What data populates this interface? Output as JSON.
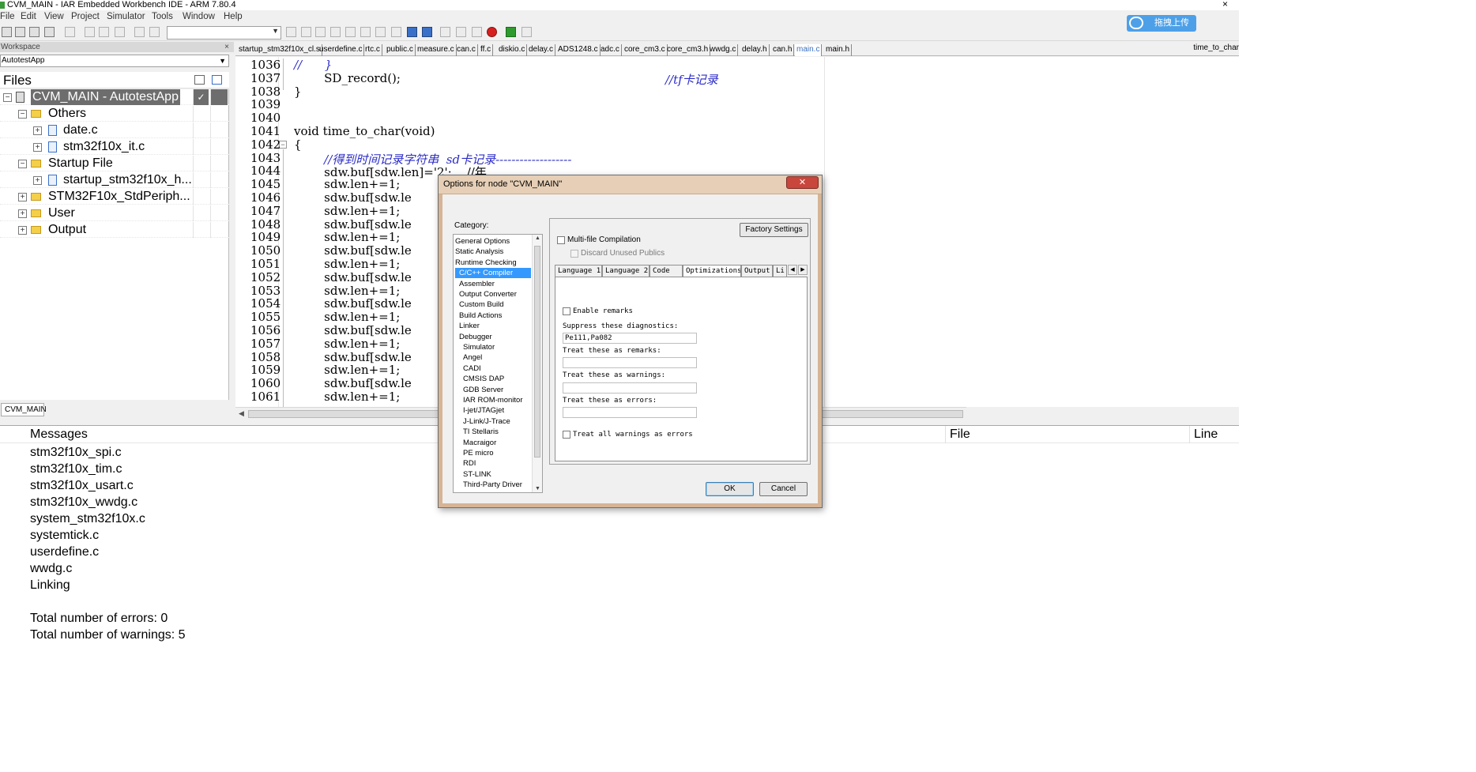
{
  "window": {
    "title": "CVM_MAIN - IAR Embedded Workbench IDE - ARM 7.80.4",
    "close_glyph": "×"
  },
  "menu": [
    "File",
    "Edit",
    "View",
    "Project",
    "Simulator",
    "Tools",
    "Window",
    "Help"
  ],
  "upload_button": "拖拽上传",
  "workspace": {
    "header": "Workspace",
    "close_glyph": "×",
    "config": "AutotestApp",
    "files_label": "Files",
    "tree": [
      {
        "label": "CVM_MAIN - AutotestApp",
        "type": "project",
        "selected": true,
        "check": "✓"
      },
      {
        "label": "Others",
        "type": "folder"
      },
      {
        "label": "date.c",
        "type": "file"
      },
      {
        "label": "stm32f10x_it.c",
        "type": "file"
      },
      {
        "label": "Startup File",
        "type": "folder"
      },
      {
        "label": "startup_stm32f10x_h...",
        "type": "file"
      },
      {
        "label": "STM32F10x_StdPeriph...",
        "type": "folder"
      },
      {
        "label": "User",
        "type": "folder"
      },
      {
        "label": "Output",
        "type": "folder"
      }
    ],
    "bottom_tab": "CVM_MAIN"
  },
  "editor": {
    "tabs": [
      "startup_stm32f10x_cl.s",
      "userdefine.c",
      "rtc.c",
      "public.c",
      "measure.c",
      "can.c",
      "ff.c",
      "diskio.c",
      "delay.c",
      "ADS1248.c",
      "adc.c",
      "core_cm3.c",
      "core_cm3.h",
      "wwdg.c",
      "delay.h",
      "can.h",
      "main.c",
      "main.h"
    ],
    "active_tab": "main.c",
    "function_combo": "time_to_char",
    "lines": [
      {
        "n": "1036",
        "code": "//      }"
      },
      {
        "n": "1037",
        "code": "        SD_record();",
        "comment": "//tf卡记录"
      },
      {
        "n": "1038",
        "code": "}"
      },
      {
        "n": "1039",
        "code": ""
      },
      {
        "n": "1040",
        "code": ""
      },
      {
        "n": "1041",
        "code": "void time_to_char(void)"
      },
      {
        "n": "1042",
        "code": "{"
      },
      {
        "n": "1043",
        "code": "        //得到时间记录字符串  sd卡记录-------------------"
      },
      {
        "n": "1044",
        "code": "        sdw.buf[sdw.len]='2';    //年"
      },
      {
        "n": "1045",
        "code": "        sdw.len+=1;"
      },
      {
        "n": "1046",
        "code": "        sdw.buf[sdw.le"
      },
      {
        "n": "1047",
        "code": "        sdw.len+=1;"
      },
      {
        "n": "1048",
        "code": "        sdw.buf[sdw.le"
      },
      {
        "n": "1049",
        "code": "        sdw.len+=1;"
      },
      {
        "n": "1050",
        "code": "        sdw.buf[sdw.le"
      },
      {
        "n": "1051",
        "code": "        sdw.len+=1;"
      },
      {
        "n": "1052",
        "code": "        sdw.buf[sdw.le"
      },
      {
        "n": "1053",
        "code": "        sdw.len+=1;"
      },
      {
        "n": "1054",
        "code": "        sdw.buf[sdw.le"
      },
      {
        "n": "1055",
        "code": "        sdw.len+=1;"
      },
      {
        "n": "1056",
        "code": "        sdw.buf[sdw.le"
      },
      {
        "n": "1057",
        "code": "        sdw.len+=1;"
      },
      {
        "n": "1058",
        "code": "        sdw.buf[sdw.le"
      },
      {
        "n": "1059",
        "code": "        sdw.len+=1;"
      },
      {
        "n": "1060",
        "code": "        sdw.buf[sdw.le"
      },
      {
        "n": "1061",
        "code": "        sdw.len+=1;"
      }
    ]
  },
  "messages": {
    "headers": {
      "messages": "Messages",
      "file": "File",
      "line": "Line"
    },
    "lines": [
      "stm32f10x_spi.c",
      "stm32f10x_tim.c",
      "stm32f10x_usart.c",
      "stm32f10x_wwdg.c",
      "system_stm32f10x.c",
      "systemtick.c",
      "userdefine.c",
      "wwdg.c",
      "Linking",
      "",
      "Total number of errors: 0",
      "Total number of warnings: 5"
    ]
  },
  "dialog": {
    "title": "Options for node \"CVM_MAIN\"",
    "close_glyph": "✕",
    "category_label": "Category:",
    "categories": [
      {
        "label": "General Options",
        "indent": 0
      },
      {
        "label": "Static Analysis",
        "indent": 0
      },
      {
        "label": "Runtime Checking",
        "indent": 0
      },
      {
        "label": "C/C++ Compiler",
        "indent": 1,
        "selected": true
      },
      {
        "label": "Assembler",
        "indent": 1
      },
      {
        "label": "Output Converter",
        "indent": 1
      },
      {
        "label": "Custom Build",
        "indent": 1
      },
      {
        "label": "Build Actions",
        "indent": 1
      },
      {
        "label": "Linker",
        "indent": 1
      },
      {
        "label": "Debugger",
        "indent": 1
      },
      {
        "label": "Simulator",
        "indent": 2
      },
      {
        "label": "Angel",
        "indent": 2
      },
      {
        "label": "CADI",
        "indent": 2
      },
      {
        "label": "CMSIS DAP",
        "indent": 2
      },
      {
        "label": "GDB Server",
        "indent": 2
      },
      {
        "label": "IAR ROM-monitor",
        "indent": 2
      },
      {
        "label": "I-jet/JTAGjet",
        "indent": 2
      },
      {
        "label": "J-Link/J-Trace",
        "indent": 2
      },
      {
        "label": "TI Stellaris",
        "indent": 2
      },
      {
        "label": "Macraigor",
        "indent": 2
      },
      {
        "label": "PE micro",
        "indent": 2
      },
      {
        "label": "RDI",
        "indent": 2
      },
      {
        "label": "ST-LINK",
        "indent": 2
      },
      {
        "label": "Third-Party Driver",
        "indent": 2
      }
    ],
    "factory_settings": "Factory Settings",
    "multi_file": "Multi-file Compilation",
    "discard_unused": "Discard Unused Publics",
    "subtabs": [
      "Language 1",
      "Language 2",
      "Code",
      "Optimizations",
      "Output",
      "Li"
    ],
    "active_subtab": "Optimizations",
    "enable_remarks": "Enable remarks",
    "suppress_label": "Suppress these diagnostics:",
    "suppress_value": "Pe111,Pa082",
    "remarks_label": "Treat these as remarks:",
    "warnings_label": "Treat these as warnings:",
    "errors_label": "Treat these as errors:",
    "treat_all_label": "Treat all warnings as errors",
    "ok": "OK",
    "cancel": "Cancel"
  }
}
